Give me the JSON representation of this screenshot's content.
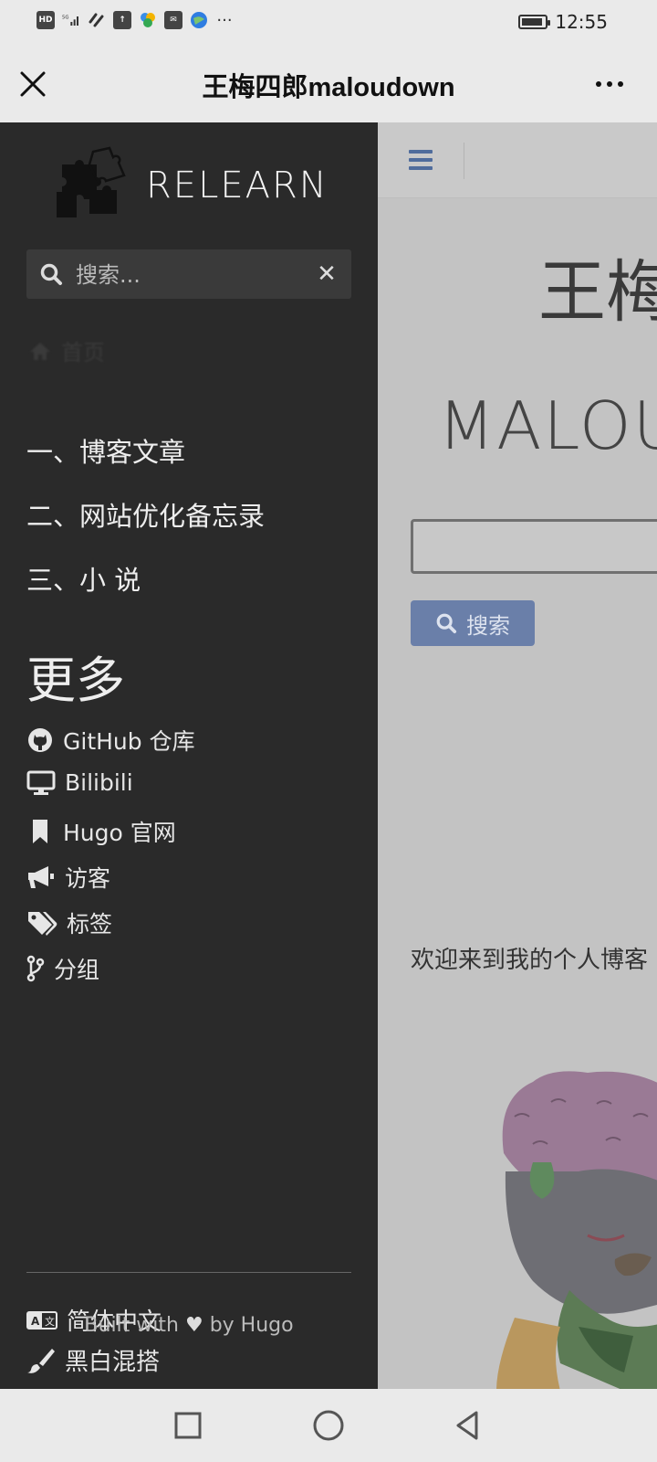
{
  "status_bar": {
    "network_label": "HD",
    "signal_label": "5G",
    "time": "12:55"
  },
  "title_bar": {
    "title": "王梅四郎maloudown"
  },
  "sidebar": {
    "logo_text": "RELEARN",
    "search_placeholder": "搜索...",
    "home_label": "首页",
    "nav_items": [
      {
        "label": "一、博客文章"
      },
      {
        "label": "二、网站优化备忘录"
      },
      {
        "label": "三、小 说"
      }
    ],
    "more_heading": "更多",
    "links": [
      {
        "label": "GitHub 仓库",
        "icon": "github-icon"
      },
      {
        "label": "Bilibili",
        "icon": "desktop-icon"
      },
      {
        "label": "Hugo 官网",
        "icon": "bookmark-icon"
      },
      {
        "label": "访客",
        "icon": "megaphone-icon"
      },
      {
        "label": "标签",
        "icon": "tags-icon"
      },
      {
        "label": "分组",
        "icon": "branch-icon"
      }
    ],
    "footer": {
      "language": "简体中文",
      "theme": "黑白混搭",
      "built_prefix": "Built with",
      "built_suffix": "by Hugo"
    }
  },
  "main": {
    "title": "王梅四郎",
    "subtitle": "MALOUDOWN",
    "search_button": "搜索",
    "welcome": "欢迎来到我的个人博客"
  },
  "colors": {
    "sidebar_bg": "#2a2a2a",
    "accent": "#4f6c9c"
  }
}
